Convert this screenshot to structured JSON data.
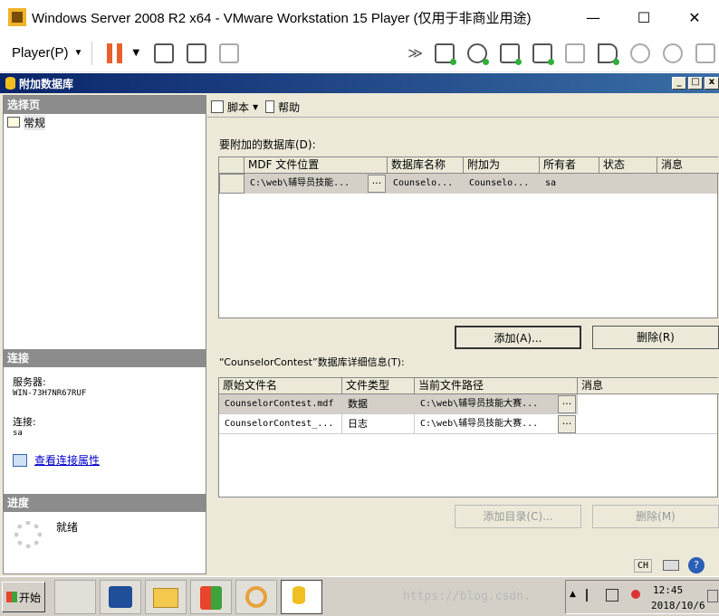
{
  "host": {
    "title": "Windows Server 2008 R2 x64 - VMware Workstation 15 Player (仅用于非商业用途)",
    "player_menu": "Player(P)",
    "minimize": "—",
    "maximize": "☐",
    "close": "✕"
  },
  "guest": {
    "window_title": "附加数据库",
    "left": {
      "select_page_header": "选择页",
      "pages": [
        "常规"
      ],
      "connection_header": "连接",
      "server_label": "服务器:",
      "server_value": "WIN-73H7NR67RUF",
      "connect_label": "连接:",
      "connect_value": "sa",
      "view_props_link": "查看连接属性",
      "progress_header": "进度",
      "progress_status": "就绪"
    },
    "toolbar": {
      "script_label": "脚本",
      "help_label": "帮助"
    },
    "attach": {
      "section_label": "要附加的数据库(D):",
      "columns": [
        "MDF 文件位置",
        "数据库名称",
        "附加为",
        "所有者",
        "状态",
        "消息"
      ],
      "rows": [
        {
          "mdf": "C:\\web\\辅导员技能...",
          "db_name": "Counselo...",
          "attach_as": "Counselo...",
          "owner": "sa",
          "status": "",
          "message": ""
        }
      ],
      "add_button": "添加(A)...",
      "remove_button": "删除(R)"
    },
    "details": {
      "section_label": "“CounselorContest”数据库详细信息(T):",
      "columns": [
        "原始文件名",
        "文件类型",
        "当前文件路径",
        "消息"
      ],
      "rows": [
        {
          "file": "CounselorContest.mdf",
          "type": "数据",
          "path": "C:\\web\\辅导员技能大赛...",
          "message": ""
        },
        {
          "file": "CounselorContest_...",
          "type": "日志",
          "path": "C:\\web\\辅导员技能大赛...",
          "message": ""
        }
      ],
      "add_catalog_button": "添加目录(C)...",
      "remove_button": "删除(M)"
    }
  },
  "taskbar": {
    "start_label": "开始",
    "lang": "CH",
    "time": "12:45",
    "date": "2018/10/6",
    "watermark": "https://blog.csdn."
  }
}
